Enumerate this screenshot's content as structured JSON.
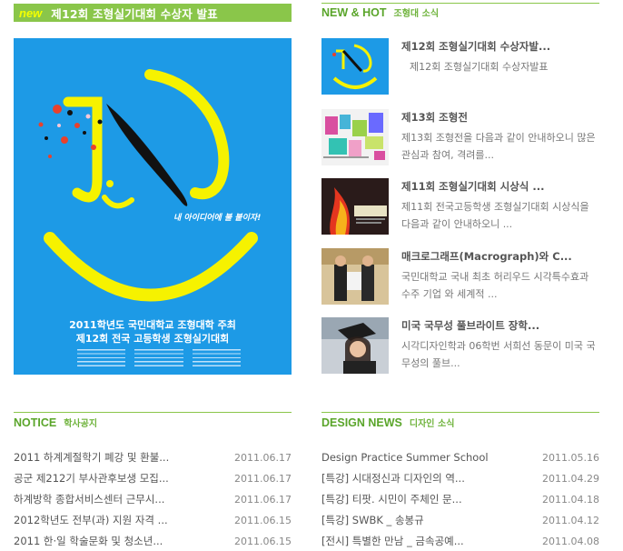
{
  "featured": {
    "badge": "new",
    "title": "제12회 조형실기대회 수상자 발표",
    "poster": {
      "slogan": "내 아이디어에 불 붙이자!",
      "line1": "2011학년도 국민대학교 조형대학 주최",
      "line2": "제12회 전국 고등학생 조형실기대회"
    }
  },
  "hot": {
    "en": "NEW & HOT",
    "ko": "조형대 소식",
    "items": [
      {
        "title": "제12회 조형실기대회 수상자발...",
        "desc": "제12회 조형실기대회 수상자발표"
      },
      {
        "title": "제13회 조형전",
        "desc": "제13회 조형전을 다음과 같이 안내하오니 많은 관심과 참여, 격려를..."
      },
      {
        "title": "제11회 조형실기대회 시상식 ...",
        "desc": "제11회 전국고등학생 조형실기대회 시상식을 다음과 같이 안내하오니 ..."
      },
      {
        "title": "매크로그래프(Macrograph)와 C...",
        "desc": "국민대학교 국내 최초 허리우드 시각특수효과 수주 기업 와 세계적 ..."
      },
      {
        "title": "미국 국무성 풀브라이트 장학...",
        "desc": "시각디자인학과 06학번 서희선 동문이 미국 국무성의 풀브..."
      }
    ]
  },
  "notice": {
    "en": "NOTICE",
    "ko": "학사공지",
    "rows": [
      {
        "text": "2011 하계계절학기 폐강 및 환불...",
        "date": "2011.06.17"
      },
      {
        "text": "공군 제212기 부사관후보생 모집...",
        "date": "2011.06.17"
      },
      {
        "text": "하계방학 종합서비스센터 근무시...",
        "date": "2011.06.17"
      },
      {
        "text": "2012학년도 전부(과) 지원 자격 ...",
        "date": "2011.06.15"
      },
      {
        "text": "2011 한·일 학술문화 및 청소년...",
        "date": "2011.06.15"
      }
    ]
  },
  "design": {
    "en": "DESIGN NEWS",
    "ko": "디자인 소식",
    "rows": [
      {
        "text": "Design Practice Summer School",
        "date": "2011.05.16"
      },
      {
        "text": "[특강] 시대정신과 디자인의 역...",
        "date": "2011.04.29"
      },
      {
        "text": "[특강] 티팟. 시민이 주체인 문...",
        "date": "2011.04.18"
      },
      {
        "text": "[특강] SWBK _ 송봉규",
        "date": "2011.04.12"
      },
      {
        "text": "[전시] 특별한 만남 _ 금속공예...",
        "date": "2011.04.08"
      }
    ]
  }
}
